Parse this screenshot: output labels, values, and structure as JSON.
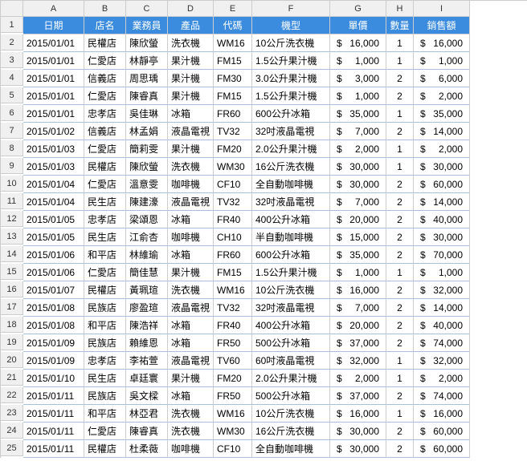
{
  "columns": [
    "A",
    "B",
    "C",
    "D",
    "E",
    "F",
    "G",
    "H",
    "I"
  ],
  "headers": [
    "日期",
    "店名",
    "業務員",
    "產品",
    "代碼",
    "機型",
    "單價",
    "數量",
    "銷售額"
  ],
  "rows": [
    {
      "date": "2015/01/01",
      "store": "民權店",
      "sales": "陳欣螢",
      "product": "洗衣機",
      "code": "WM16",
      "model": "10公斤洗衣機",
      "price": 16000,
      "qty": 1,
      "amount": 16000
    },
    {
      "date": "2015/01/01",
      "store": "仁愛店",
      "sales": "林靜亭",
      "product": "果汁機",
      "code": "FM15",
      "model": "1.5公升果汁機",
      "price": 1000,
      "qty": 1,
      "amount": 1000
    },
    {
      "date": "2015/01/01",
      "store": "信義店",
      "sales": "周思瑀",
      "product": "果汁機",
      "code": "FM30",
      "model": "3.0公升果汁機",
      "price": 3000,
      "qty": 2,
      "amount": 6000
    },
    {
      "date": "2015/01/01",
      "store": "仁愛店",
      "sales": "陳睿真",
      "product": "果汁機",
      "code": "FM15",
      "model": "1.5公升果汁機",
      "price": 1000,
      "qty": 2,
      "amount": 2000
    },
    {
      "date": "2015/01/01",
      "store": "忠孝店",
      "sales": "吳佳琳",
      "product": "冰箱",
      "code": "FR60",
      "model": "600公升冰箱",
      "price": 35000,
      "qty": 1,
      "amount": 35000
    },
    {
      "date": "2015/01/02",
      "store": "信義店",
      "sales": "林孟娟",
      "product": "液晶電視",
      "code": "TV32",
      "model": "32吋液晶電視",
      "price": 7000,
      "qty": 2,
      "amount": 14000
    },
    {
      "date": "2015/01/03",
      "store": "仁愛店",
      "sales": "簡莉雯",
      "product": "果汁機",
      "code": "FM20",
      "model": "2.0公升果汁機",
      "price": 2000,
      "qty": 1,
      "amount": 2000
    },
    {
      "date": "2015/01/03",
      "store": "民權店",
      "sales": "陳欣螢",
      "product": "洗衣機",
      "code": "WM30",
      "model": "16公斤洗衣機",
      "price": 30000,
      "qty": 1,
      "amount": 30000
    },
    {
      "date": "2015/01/04",
      "store": "仁愛店",
      "sales": "溫意雯",
      "product": "咖啡機",
      "code": "CF10",
      "model": "全自動咖啡機",
      "price": 30000,
      "qty": 2,
      "amount": 60000
    },
    {
      "date": "2015/01/04",
      "store": "民生店",
      "sales": "陳建濠",
      "product": "液晶電視",
      "code": "TV32",
      "model": "32吋液晶電視",
      "price": 7000,
      "qty": 2,
      "amount": 14000
    },
    {
      "date": "2015/01/05",
      "store": "忠孝店",
      "sales": "梁頌恩",
      "product": "冰箱",
      "code": "FR40",
      "model": "400公升冰箱",
      "price": 20000,
      "qty": 2,
      "amount": 40000
    },
    {
      "date": "2015/01/05",
      "store": "民生店",
      "sales": "江俞杏",
      "product": "咖啡機",
      "code": "CH10",
      "model": "半自動咖啡機",
      "price": 15000,
      "qty": 2,
      "amount": 30000
    },
    {
      "date": "2015/01/06",
      "store": "和平店",
      "sales": "林維瑜",
      "product": "冰箱",
      "code": "FR60",
      "model": "600公升冰箱",
      "price": 35000,
      "qty": 2,
      "amount": 70000
    },
    {
      "date": "2015/01/06",
      "store": "仁愛店",
      "sales": "簡佳慧",
      "product": "果汁機",
      "code": "FM15",
      "model": "1.5公升果汁機",
      "price": 1000,
      "qty": 1,
      "amount": 1000
    },
    {
      "date": "2015/01/07",
      "store": "民權店",
      "sales": "黃珮瑄",
      "product": "洗衣機",
      "code": "WM16",
      "model": "10公斤洗衣機",
      "price": 16000,
      "qty": 2,
      "amount": 32000
    },
    {
      "date": "2015/01/08",
      "store": "民族店",
      "sales": "廖盈瑄",
      "product": "液晶電視",
      "code": "TV32",
      "model": "32吋液晶電視",
      "price": 7000,
      "qty": 2,
      "amount": 14000
    },
    {
      "date": "2015/01/08",
      "store": "和平店",
      "sales": "陳浩祥",
      "product": "冰箱",
      "code": "FR40",
      "model": "400公升冰箱",
      "price": 20000,
      "qty": 2,
      "amount": 40000
    },
    {
      "date": "2015/01/09",
      "store": "民族店",
      "sales": "賴維恩",
      "product": "冰箱",
      "code": "FR50",
      "model": "500公升冰箱",
      "price": 37000,
      "qty": 2,
      "amount": 74000
    },
    {
      "date": "2015/01/09",
      "store": "忠孝店",
      "sales": "李祐萱",
      "product": "液晶電視",
      "code": "TV60",
      "model": "60吋液晶電視",
      "price": 32000,
      "qty": 1,
      "amount": 32000
    },
    {
      "date": "2015/01/10",
      "store": "民生店",
      "sales": "卓廷寰",
      "product": "果汁機",
      "code": "FM20",
      "model": "2.0公升果汁機",
      "price": 2000,
      "qty": 1,
      "amount": 2000
    },
    {
      "date": "2015/01/11",
      "store": "民族店",
      "sales": "吳文樑",
      "product": "冰箱",
      "code": "FR50",
      "model": "500公升冰箱",
      "price": 37000,
      "qty": 2,
      "amount": 74000
    },
    {
      "date": "2015/01/11",
      "store": "和平店",
      "sales": "林亞君",
      "product": "洗衣機",
      "code": "WM16",
      "model": "10公斤洗衣機",
      "price": 16000,
      "qty": 1,
      "amount": 16000
    },
    {
      "date": "2015/01/11",
      "store": "仁愛店",
      "sales": "陳睿真",
      "product": "洗衣機",
      "code": "WM30",
      "model": "16公斤洗衣機",
      "price": 30000,
      "qty": 2,
      "amount": 60000
    },
    {
      "date": "2015/01/11",
      "store": "民權店",
      "sales": "杜柔薇",
      "product": "咖啡機",
      "code": "CF10",
      "model": "全自動咖啡機",
      "price": 30000,
      "qty": 2,
      "amount": 60000
    }
  ]
}
